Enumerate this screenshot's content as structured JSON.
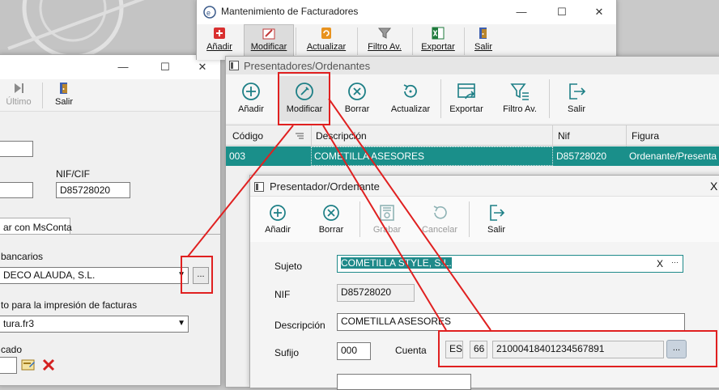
{
  "bg_window": {
    "buttons": {
      "ultimo": "Último",
      "salir": "Salir"
    },
    "nif_label": "NIF/CIF",
    "nif_value": "D85728020",
    "tab_label": "ar con MsConta",
    "bank_section_label": "bancarios",
    "bank_value": "DECO ALAUDA, S.L.",
    "ellipsis": "...",
    "print_label": "to para la impresión de facturas",
    "print_value": "tura.fr3",
    "cado_label": "cado"
  },
  "mant_window": {
    "title": "Mantenimiento de Facturadores",
    "buttons": {
      "anadir": "Añadir",
      "modificar": "Modificar",
      "actualizar": "Actualizar",
      "filtro": "Filtro Av.",
      "exportar": "Exportar",
      "salir": "Salir"
    }
  },
  "pres_window": {
    "title": "Presentadores/Ordenantes",
    "buttons": {
      "anadir": "Añadir",
      "modificar": "Modificar",
      "borrar": "Borrar",
      "actualizar": "Actualizar",
      "exportar": "Exportar",
      "filtro": "Filtro Av.",
      "salir": "Salir"
    },
    "columns": {
      "codigo": "Código",
      "descripcion": "Descripción",
      "nif": "Nif",
      "figura": "Figura"
    },
    "row": {
      "codigo": "003",
      "descripcion": "COMETILLA ASESORES",
      "nif": "D85728020",
      "figura": "Ordenante/Presenta"
    }
  },
  "detail_window": {
    "title": "Presentador/Ordenante",
    "close": "X",
    "buttons": {
      "anadir": "Añadir",
      "borrar": "Borrar",
      "grabar": "Grabar",
      "cancelar": "Cancelar",
      "salir": "Salir"
    },
    "labels": {
      "sujeto": "Sujeto",
      "nif": "NIF",
      "descripcion": "Descripción",
      "sufijo": "Sufijo",
      "cuenta": "Cuenta"
    },
    "values": {
      "sujeto": "COMETILLA STYLE, S.L.",
      "sujeto_clear": "X",
      "sujeto_more": "···",
      "nif": "D85728020",
      "descripcion": "COMETILLA ASESORES",
      "sufijo": "000",
      "iban_country": "ES",
      "iban_check": "66",
      "account": "21000418401234567891",
      "account_more": "..."
    }
  },
  "colors": {
    "accent": "#1f8a8a",
    "selection": "#1a8f8a",
    "highlight_red": "#e02020"
  }
}
